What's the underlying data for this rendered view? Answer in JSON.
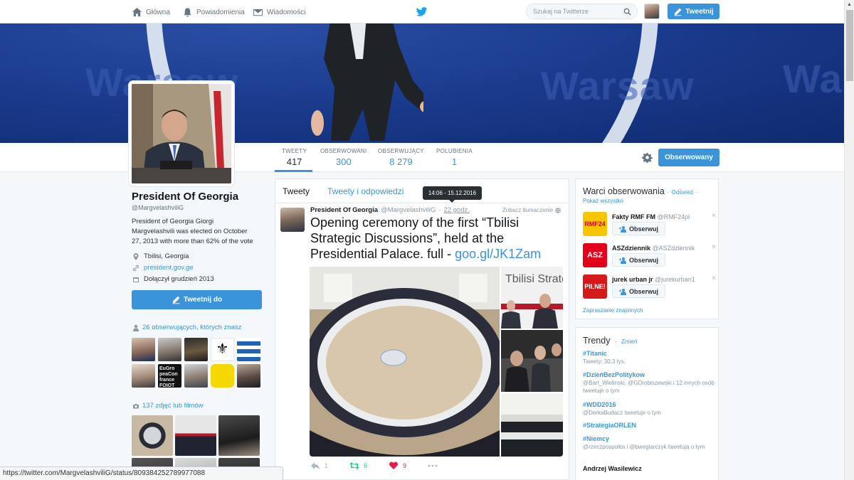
{
  "topnav": {
    "home": "Główna",
    "notifications": "Powiadomienia",
    "messages": "Wiadomości",
    "search_placeholder": "Szukaj na Twitterze",
    "tweet_button": "Tweetnij"
  },
  "profile_nav": {
    "stats": [
      {
        "label": "TWEETY",
        "value": "417"
      },
      {
        "label": "OBSERWOWANI",
        "value": "300"
      },
      {
        "label": "OBSERWUJĄCY",
        "value": "8 279"
      },
      {
        "label": "POLUBIENIA",
        "value": "1"
      }
    ],
    "follow_button": "Obserwowany"
  },
  "profile": {
    "name": "President Of Georgia",
    "handle": "@MargvelashviliG",
    "bio": "President of Georgia Giorgi Margvelashvili was elected on October 27, 2013 with more than 62% of the vote",
    "location": "Tbilisi, Georgia",
    "website": "president.gov.ge",
    "joined": "Dołączył grudzień 2013",
    "tweet_to": "Tweetnij do",
    "followers_you_know": "26 obserwujących, których znasz",
    "media_count": "137 zdjęć lub filmów"
  },
  "timeline": {
    "tabs": [
      "Tweety",
      "Tweety i odpowiedzi"
    ],
    "tooltip": "14:06 - 15.12.2016",
    "tweet": {
      "name": "President Of Georgia",
      "handle": "@MargvelashviliG",
      "sep": "·",
      "time": "22 godz.",
      "translate": "Zobacz tłumaczenie",
      "text": "Opening ceremony of the first “Tbilisi Strategic Discussions”, held at the Presidential Palace. full - ",
      "link": "goo.gl/JK1Zam",
      "photo_caption": "Tbilisi Strategic Discussion",
      "reply_count": "1",
      "retweet_count": "6",
      "like_count": "9"
    }
  },
  "who_to_follow": {
    "title": "Warci obserwowania",
    "sep1": "·",
    "refresh": "Odśwież",
    "sep2": "·",
    "show_all": "Pokaż wszystko",
    "follow_label": "Obserwuj",
    "close": "×",
    "accounts": [
      {
        "name": "Fakty RMF FM",
        "handle": "@RMF24pl",
        "logo": "RMF24",
        "logo_color": "#f7c600"
      },
      {
        "name": "ASZdziennik",
        "handle": "@ASZdziennik",
        "logo": "ASZ",
        "logo_color": "#e3001b"
      },
      {
        "name": "jurek urban jr",
        "handle": "@jurekurban1",
        "logo": "PILNE!",
        "logo_color": "#d41a1a"
      }
    ],
    "invite": "Zapraszanie znajomych"
  },
  "trends": {
    "title": "Trendy",
    "sep": "·",
    "change": "Zmień",
    "items": [
      {
        "tag": "#Titanic",
        "desc": "Tweety: 30,3 tys."
      },
      {
        "tag": "#DzieńBezPolitykow",
        "desc": "@Bart_Wielinski, @GDrobiszewski i 12 innych osób tweetuje o tym"
      },
      {
        "tag": "#WDD2016",
        "desc": "@DorkaBudacz tweetuje o tym"
      },
      {
        "tag": "#StrategiaORLEN",
        "desc": ""
      },
      {
        "tag": "#Niemcy",
        "desc": "@rzeczpospolita i @bweglarczyk tweetują o tym"
      },
      {
        "tag": "Andrzej Wasilewicz",
        "desc": ""
      }
    ]
  },
  "banner_words": [
    "Warsaw",
    "Warsaw",
    "Wa"
  ],
  "statusbar": "https://twitter.com/MargvelashviliG/status/809384252789977088",
  "colors": {
    "accent": "#3b94d9",
    "like": "#e81c4f",
    "retweet": "#19cf86"
  }
}
